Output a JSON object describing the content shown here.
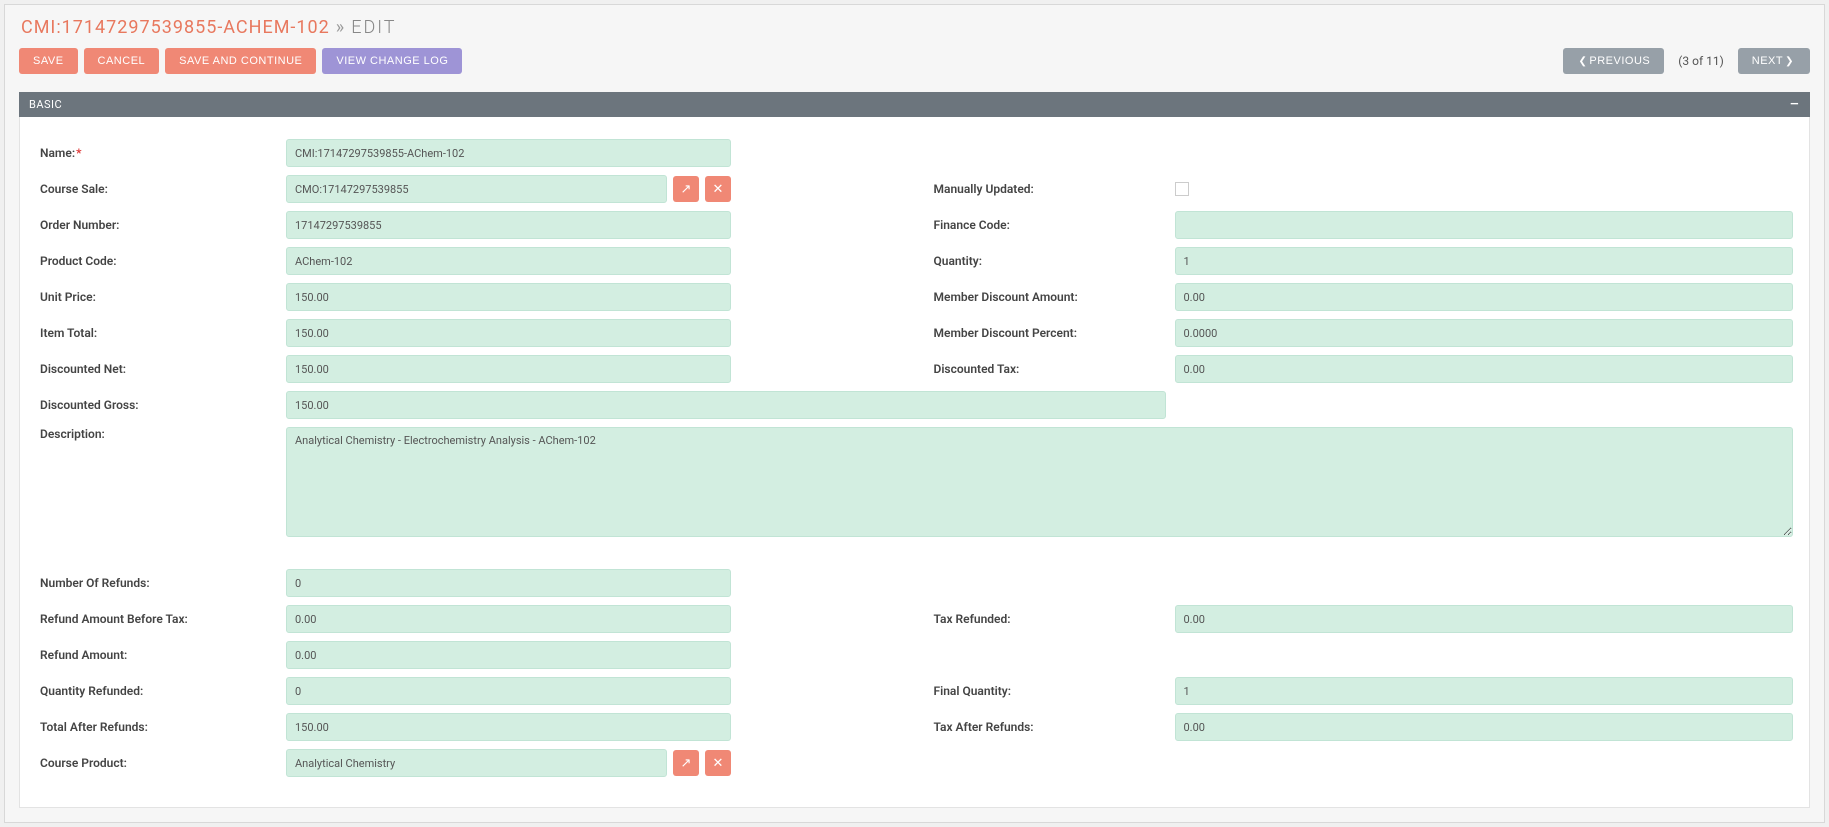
{
  "header": {
    "title_main": "CMI:17147297539855-ACHEM-102",
    "title_sep": "»",
    "title_sub": "EDIT"
  },
  "toolbar": {
    "save": "SAVE",
    "cancel": "CANCEL",
    "save_continue": "SAVE AND CONTINUE",
    "view_log": "VIEW CHANGE LOG",
    "previous": "PREVIOUS",
    "pager": "(3 of 11)",
    "next": "NEXT"
  },
  "section": {
    "basic_title": "BASIC"
  },
  "labels": {
    "name": "Name:",
    "course_sale": "Course Sale:",
    "manually_updated": "Manually Updated:",
    "order_number": "Order Number:",
    "finance_code": "Finance Code:",
    "product_code": "Product Code:",
    "quantity": "Quantity:",
    "unit_price": "Unit Price:",
    "member_discount_amount": "Member Discount Amount:",
    "item_total": "Item Total:",
    "member_discount_percent": "Member Discount Percent:",
    "discounted_net": "Discounted Net:",
    "discounted_tax": "Discounted Tax:",
    "discounted_gross": "Discounted Gross:",
    "description": "Description:",
    "number_of_refunds": "Number Of Refunds:",
    "refund_amount_before_tax": "Refund Amount Before Tax:",
    "tax_refunded": "Tax Refunded:",
    "refund_amount": "Refund Amount:",
    "quantity_refunded": "Quantity Refunded:",
    "final_quantity": "Final Quantity:",
    "total_after_refunds": "Total After Refunds:",
    "tax_after_refunds": "Tax After Refunds:",
    "course_product": "Course Product:"
  },
  "values": {
    "name": "CMI:17147297539855-AChem-102",
    "course_sale": "CMO:17147297539855",
    "order_number": "17147297539855",
    "finance_code": "",
    "product_code": "AChem-102",
    "quantity": "1",
    "unit_price": "150.00",
    "member_discount_amount": "0.00",
    "item_total": "150.00",
    "member_discount_percent": "0.0000",
    "discounted_net": "150.00",
    "discounted_tax": "0.00",
    "discounted_gross": "150.00",
    "description": "Analytical Chemistry - Electrochemistry Analysis - AChem-102",
    "number_of_refunds": "0",
    "refund_amount_before_tax": "0.00",
    "tax_refunded": "0.00",
    "refund_amount": "0.00",
    "quantity_refunded": "0",
    "final_quantity": "1",
    "total_after_refunds": "150.00",
    "tax_after_refunds": "0.00",
    "course_product": "Analytical Chemistry"
  }
}
